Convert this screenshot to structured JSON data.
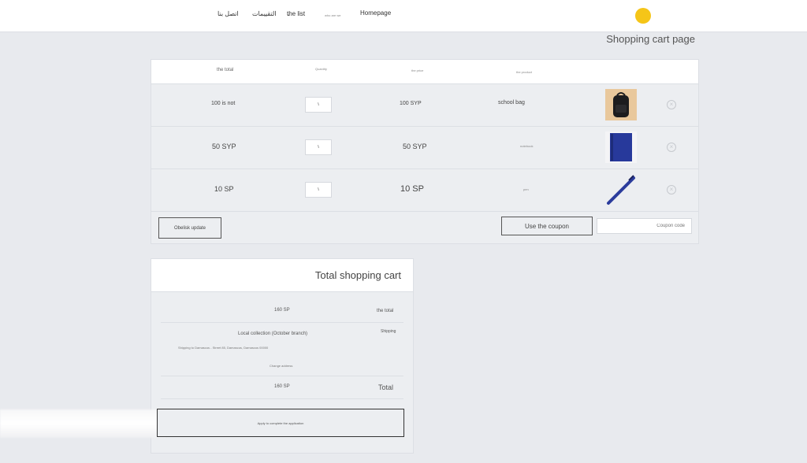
{
  "nav": {
    "items": [
      {
        "label": "اتصل بنا"
      },
      {
        "label": "التقييمات"
      },
      {
        "label": "the list"
      },
      {
        "label": "who are we"
      },
      {
        "label": "Homepage"
      }
    ]
  },
  "page": {
    "title": "Shopping cart page"
  },
  "cart": {
    "headers": {
      "total": "the total",
      "quantity": "Quantity",
      "price": "the price",
      "product": "the product"
    },
    "rows": [
      {
        "total": "100 is not",
        "quantity": "١",
        "price": "100 SYP",
        "name": "school bag",
        "image": "backpack"
      },
      {
        "total": "50 SYP",
        "quantity": "١",
        "price": "50 SYP",
        "name": "notebook",
        "image": "blue-notebook"
      },
      {
        "total": "10 SP",
        "quantity": "١",
        "price": "10 SP",
        "name": "pen",
        "image": "blue-pen"
      }
    ],
    "update_label": "Obelisk update",
    "coupon_button": "Use the coupon",
    "coupon_placeholder": "Coupon code"
  },
  "totals": {
    "title": "Total shopping cart",
    "subtotal_label": "the total",
    "subtotal_value": "160 SP",
    "shipping_label": "Shipping",
    "shipping_method": "Local collection (October branch)",
    "shipping_address": "Shipping to Damascus - Street 85, Damascus, Damascus 00000",
    "change_address": "Change address",
    "total_label": "Total",
    "total_value": "160 SP",
    "apply_label": "Apply to complete the application"
  },
  "colors": {
    "accent": "#f5c518",
    "background": "#e8eaee"
  }
}
